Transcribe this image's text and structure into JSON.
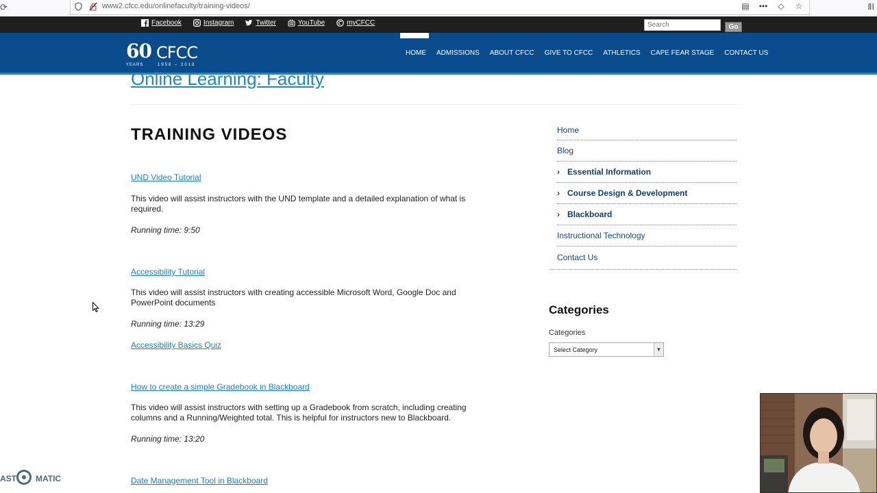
{
  "browser": {
    "url": "www2.cfcc.edu/onlinefaculty/training-videos/"
  },
  "social": [
    {
      "label": "Facebook",
      "icon": "facebook-icon"
    },
    {
      "label": "Instagram",
      "icon": "instagram-icon"
    },
    {
      "label": "Twitter",
      "icon": "twitter-icon"
    },
    {
      "label": "YouTube",
      "icon": "youtube-icon"
    },
    {
      "label": "myCFCC",
      "icon": "mycfcc-icon"
    }
  ],
  "search": {
    "placeholder": "Search",
    "button": "Go"
  },
  "logo": {
    "number": "60",
    "name": "CFCC",
    "years": "YEARS",
    "range": "1958 – 2018"
  },
  "nav": [
    "HOME",
    "ADMISSIONS",
    "ABOUT CFCC",
    "GIVE TO CFCC",
    "ATHLETICS",
    "CAPE FEAR STAGE",
    "CONTACT US"
  ],
  "page": {
    "title": "Online Learning: Faculty",
    "heading": "TRAINING VIDEOS"
  },
  "items": [
    {
      "link": "UND Video Tutorial",
      "desc": "This video will assist instructors with the UND template and a detailed explanation of what is required.",
      "time": "Running time: 9:50"
    },
    {
      "link": "Accessibility Tutorial",
      "desc": "This video will assist instructors with creating accessible  Microsoft Word, Google Doc and PowerPoint documents",
      "time": "Running time: 13:29",
      "extra_link": "Accessibility Basics Quiz"
    },
    {
      "link": "How to create a simple Gradebook in Blackboard",
      "desc": "This video will assist instructors with setting up a Gradebook from scratch, including creating columns and a Running/Weighted total.  This is helpful for instructors new to Blackboard.",
      "time": "Running time: 13:20"
    },
    {
      "link": "Date Management Tool in Blackboard"
    }
  ],
  "sidebar": {
    "menu": [
      {
        "label": "Home",
        "expandable": false
      },
      {
        "label": "Blog",
        "expandable": false
      },
      {
        "label": "Essential Information",
        "expandable": true
      },
      {
        "label": "Course Design & Development",
        "expandable": true
      },
      {
        "label": "Blackboard",
        "expandable": true
      },
      {
        "label": "Instructional Technology",
        "expandable": false
      },
      {
        "label": "Contact Us",
        "expandable": false
      }
    ],
    "categories_heading": "Categories",
    "categories_label": "Categories",
    "categories_selected": "Select Category"
  },
  "watermark": {
    "left": "AST",
    "right": "MATIC"
  },
  "colors": {
    "header": "#0a4b8c",
    "topbar": "#1f1f1f",
    "link": "#1d7fc0",
    "sidebar_link": "#0b4a85"
  }
}
